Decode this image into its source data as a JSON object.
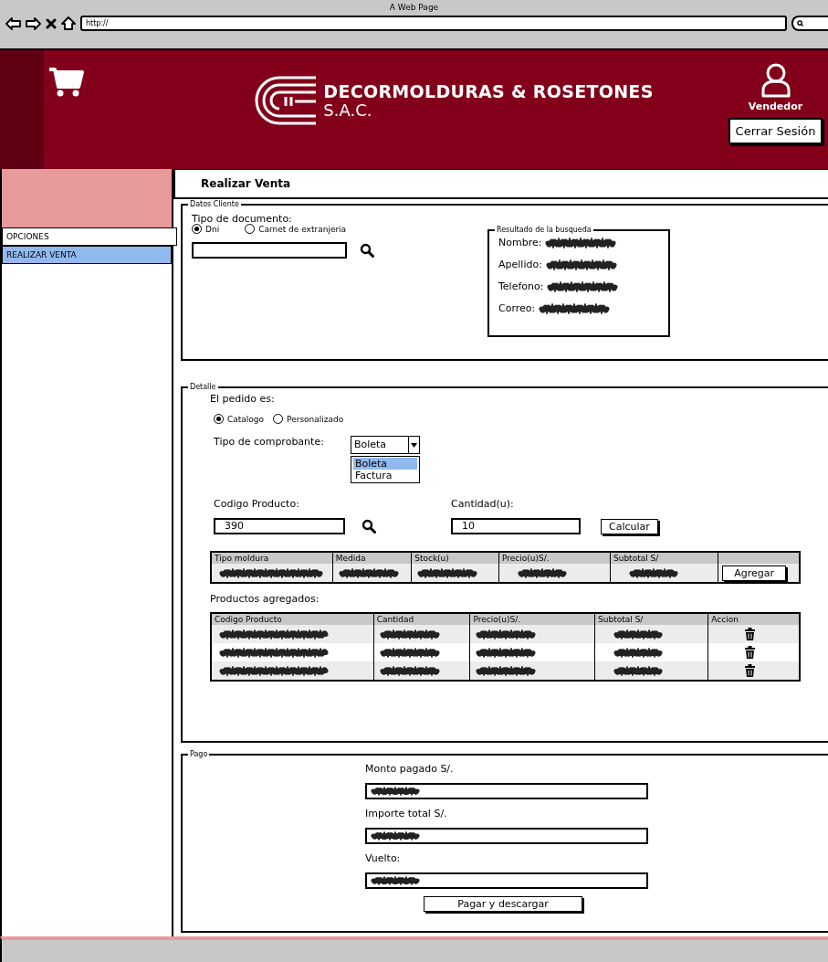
{
  "browser": {
    "title": "A Web Page",
    "url": "http://"
  },
  "header": {
    "brand": "DECORMOLDURAS & ROSETONES",
    "brand_sub": "S.A.C.",
    "user": "Vendedor",
    "logout": "Cerrar Sesión"
  },
  "sidebar": {
    "items": [
      {
        "label": "OPCIONES",
        "selected": false
      },
      {
        "label": "REALIZAR VENTA",
        "selected": true
      }
    ]
  },
  "page_title": "Realizar Venta",
  "cliente": {
    "legend": "Datos Cliente",
    "doc_label": "Tipo de documento:",
    "doc_options": [
      {
        "label": "Dni",
        "selected": true
      },
      {
        "label": "Carnet de extranjeria",
        "selected": false
      }
    ],
    "result": {
      "legend": "Resultado de la busqueda",
      "fields": [
        {
          "label": "Nombre:",
          "kind": "placeholder"
        },
        {
          "label": "Apellido:",
          "kind": "placeholder"
        },
        {
          "label": "Telefono:",
          "kind": "placeholder"
        },
        {
          "label": "Correo:",
          "kind": "placeholder"
        }
      ]
    }
  },
  "detalle": {
    "legend": "Detalle",
    "pedido_label": "El pedido es:",
    "pedido_options": [
      {
        "label": "Catalogo",
        "selected": true
      },
      {
        "label": "Personalizado",
        "selected": false
      }
    ],
    "comprobante_label": "Tipo de comprobante:",
    "comprobante_value": "Boleta",
    "comprobante_options": [
      {
        "label": "Boleta",
        "selected": true
      },
      {
        "label": "Factura",
        "selected": false
      }
    ],
    "codigo_label": "Codigo Producto:",
    "codigo_value": "390",
    "cantidad_label": "Cantidad(u):",
    "cantidad_value": "10",
    "calcular": "Calcular",
    "product_table": {
      "columns": [
        "Tipo moldura",
        "Medida",
        "Stock(u)",
        "Precio(u)S/.",
        "Subtotal S/"
      ],
      "rows": [
        {
          "kind": "placeholder"
        }
      ],
      "button": "Agregar"
    },
    "added_label": "Productos agregados:",
    "added_table": {
      "columns": [
        "Codigo Producto",
        "Cantidad",
        "Precio(u)S/.",
        "Subtotal S/",
        "Accion"
      ],
      "rows": [
        {
          "kind": "placeholder"
        },
        {
          "kind": "placeholder"
        },
        {
          "kind": "placeholder"
        }
      ]
    }
  },
  "pago": {
    "legend": "Pago",
    "fields": [
      {
        "label": "Monto pagado S/.",
        "kind": "placeholder"
      },
      {
        "label": "Importe total S/.",
        "kind": "placeholder"
      },
      {
        "label": "Vuelto:",
        "kind": "placeholder"
      }
    ],
    "button": "Pagar y descargar"
  }
}
